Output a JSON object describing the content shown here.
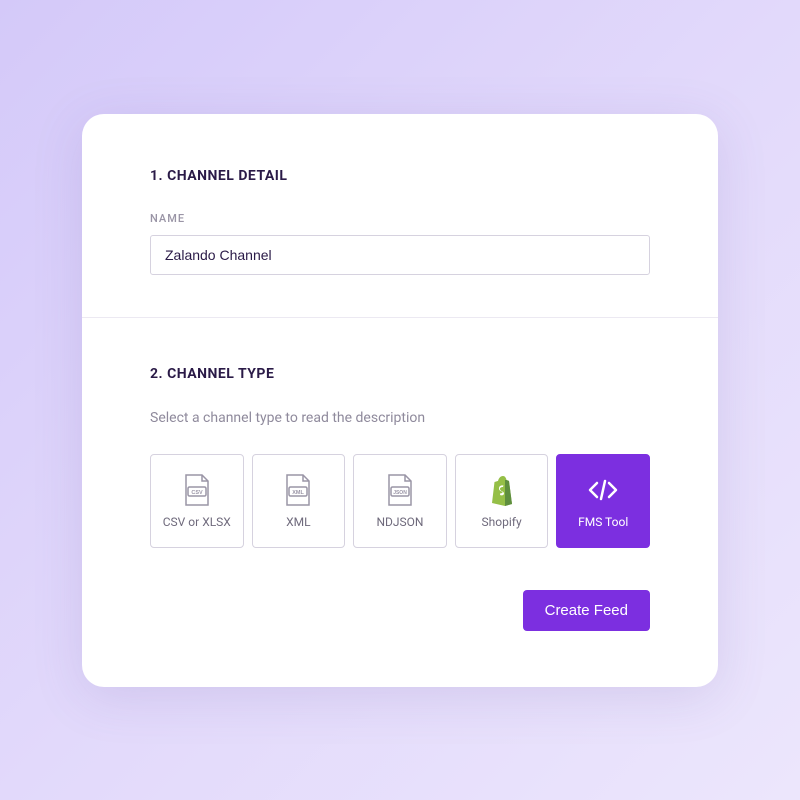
{
  "section1": {
    "title": "1. CHANNEL DETAIL",
    "name_label": "NAME",
    "name_value": "Zalando Channel"
  },
  "section2": {
    "title": "2. CHANNEL TYPE",
    "hint": "Select a channel type to read the description",
    "types": [
      {
        "id": "csv",
        "label": "CSV or XLSX",
        "selected": false
      },
      {
        "id": "xml",
        "label": "XML",
        "selected": false
      },
      {
        "id": "ndjson",
        "label": "NDJSON",
        "selected": false
      },
      {
        "id": "shopify",
        "label": "Shopify",
        "selected": false
      },
      {
        "id": "fms",
        "label": "FMS Tool",
        "selected": true
      }
    ],
    "create_label": "Create Feed"
  },
  "colors": {
    "accent": "#7c2fe0",
    "shopify_green": "#95bf47"
  }
}
